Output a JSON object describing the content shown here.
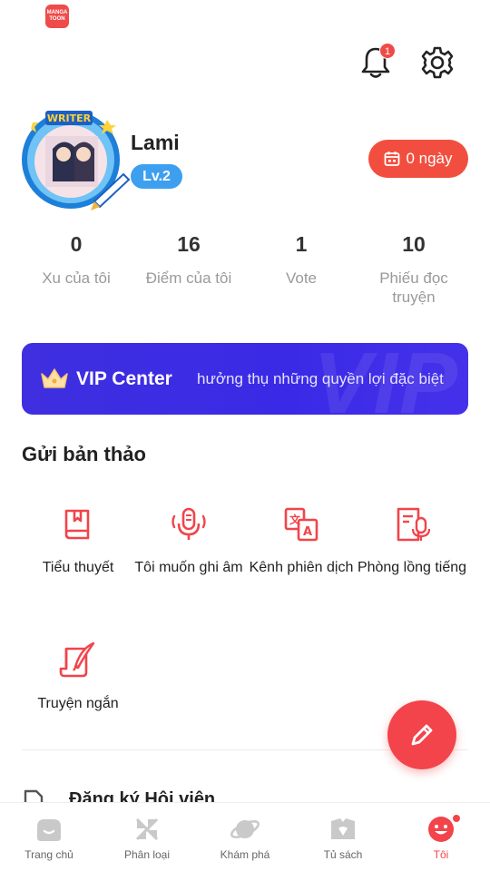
{
  "app": {
    "logo_line1": "MANGA",
    "logo_line2": "TOON"
  },
  "header": {
    "notification_count": "1"
  },
  "profile": {
    "avatar_caption": "WRITER",
    "name": "Lami",
    "level": "Lv.2",
    "streak": "0 ngày"
  },
  "stats": [
    {
      "value": "0",
      "label": "Xu của tôi"
    },
    {
      "value": "16",
      "label": "Điểm của tôi"
    },
    {
      "value": "1",
      "label": "Vote"
    },
    {
      "value": "10",
      "label": "Phiếu đọc truyện"
    }
  ],
  "vip": {
    "title": "VIP Center",
    "subtitle": "hưởng thụ những quyền lợi đặc biệt",
    "watermark": "VIP"
  },
  "submit": {
    "title": "Gửi bản thảo",
    "items": [
      {
        "label": "Tiểu thuyết",
        "icon": "book-icon"
      },
      {
        "label": "Tôi muốn ghi âm",
        "icon": "microphone-icon"
      },
      {
        "label": "Kênh phiên dịch",
        "icon": "translate-icon"
      },
      {
        "label": "Phòng lồng tiếng",
        "icon": "dubbing-icon"
      },
      {
        "label": "Truyện ngắn",
        "icon": "quill-scroll-icon"
      }
    ]
  },
  "membership": {
    "label": "Đăng ký Hội viên"
  },
  "nav": [
    {
      "label": "Trang chủ",
      "icon": "home-icon"
    },
    {
      "label": "Phân loại",
      "icon": "category-icon"
    },
    {
      "label": "Khám phá",
      "icon": "planet-icon"
    },
    {
      "label": "Tủ sách",
      "icon": "bookshelf-icon"
    },
    {
      "label": "Tôi",
      "icon": "me-icon",
      "active": true
    }
  ],
  "colors": {
    "accent": "#f2444a",
    "vip": "#3a2ae6",
    "level": "#3d9ff0"
  }
}
